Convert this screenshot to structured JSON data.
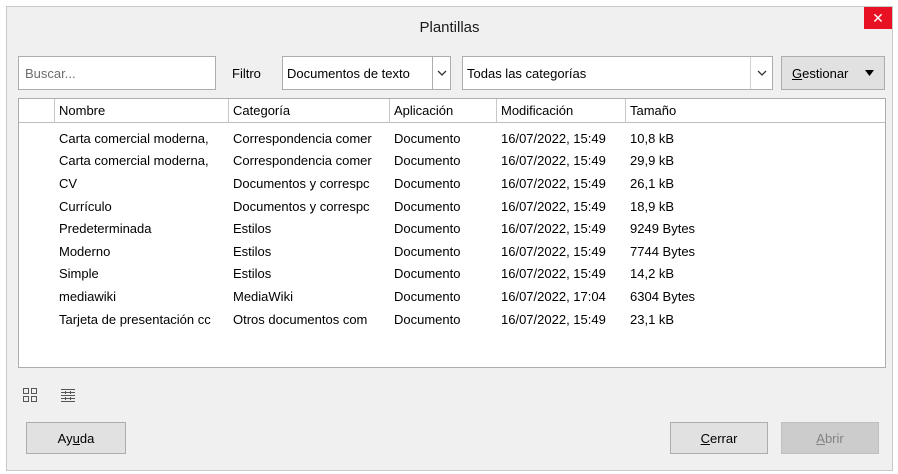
{
  "window": {
    "title": "Plantillas",
    "close_glyph": "✕"
  },
  "search": {
    "placeholder": "Buscar...",
    "value": ""
  },
  "filter": {
    "label": "Filtro",
    "selected": "Documentos de texto"
  },
  "category": {
    "selected": "Todas las categorías"
  },
  "manage": {
    "label_prefix": "G",
    "label_rest": "estionar"
  },
  "table": {
    "columns": [
      "Nombre",
      "Categoría",
      "Aplicación",
      "Modificación",
      "Tamaño"
    ],
    "rows": [
      [
        "Carta comercial moderna,",
        "Correspondencia comer",
        "Documento",
        "16/07/2022, 15:49",
        "10,8 kB"
      ],
      [
        "Carta comercial moderna,",
        "Correspondencia comer",
        "Documento",
        "16/07/2022, 15:49",
        "29,9 kB"
      ],
      [
        "CV",
        "Documentos y correspc",
        "Documento",
        "16/07/2022, 15:49",
        "26,1 kB"
      ],
      [
        "Currículo",
        "Documentos y correspc",
        "Documento",
        "16/07/2022, 15:49",
        "18,9 kB"
      ],
      [
        "Predeterminada",
        "Estilos",
        "Documento",
        "16/07/2022, 15:49",
        "9249 Bytes"
      ],
      [
        "Moderno",
        "Estilos",
        "Documento",
        "16/07/2022, 15:49",
        "7744 Bytes"
      ],
      [
        "Simple",
        "Estilos",
        "Documento",
        "16/07/2022, 15:49",
        "14,2 kB"
      ],
      [
        "mediawiki",
        "MediaWiki",
        "Documento",
        "16/07/2022, 17:04",
        "6304 Bytes"
      ],
      [
        "Tarjeta de presentación cc",
        "Otros documentos com",
        "Documento",
        "16/07/2022, 15:49",
        "23,1 kB"
      ]
    ]
  },
  "view_modes": {
    "thumbnail": "thumbnail-view-icon",
    "list": "list-view-icon"
  },
  "buttons": {
    "help": {
      "pre": "Ay",
      "u": "u",
      "post": "da"
    },
    "close": {
      "pre": "",
      "u": "C",
      "post": "errar"
    },
    "open": {
      "pre": "",
      "u": "A",
      "post": "brir"
    }
  },
  "colors": {
    "close_button": "#e81123",
    "disabled_text": "#838383"
  }
}
